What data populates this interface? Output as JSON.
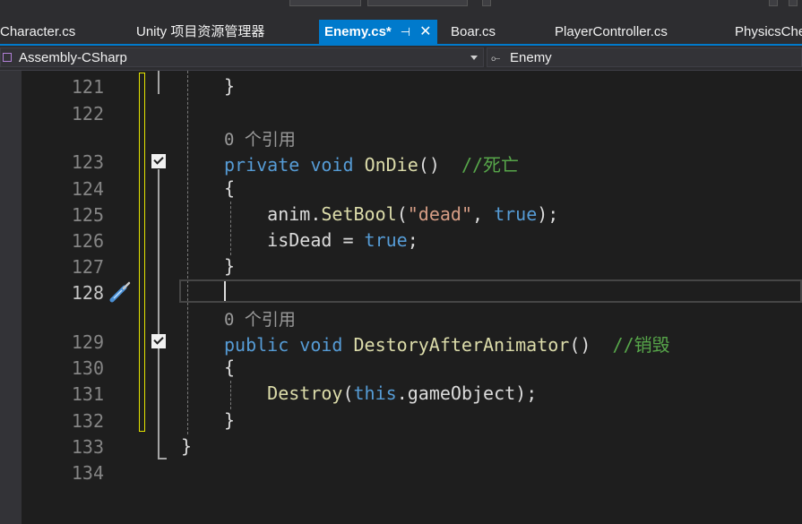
{
  "tabs": [
    {
      "label": "Character.cs",
      "active": false
    },
    {
      "label": "Unity 项目资源管理器",
      "active": false
    },
    {
      "label": "Enemy.cs*",
      "active": true
    },
    {
      "label": "Boar.cs",
      "active": false
    },
    {
      "label": "PlayerController.cs",
      "active": false
    },
    {
      "label": "PhysicsChe",
      "active": false
    }
  ],
  "tab_icons": {
    "pin": "pin-icon",
    "close": "close-icon"
  },
  "navbar": {
    "project": "Assembly-CSharp",
    "class": "Enemy",
    "project_icon": "cs-project-icon",
    "class_icon": "class-icon"
  },
  "editor": {
    "line_numbers": [
      "121",
      "122",
      "123",
      "124",
      "125",
      "126",
      "127",
      "128",
      "129",
      "130",
      "131",
      "132",
      "133",
      "134"
    ],
    "codelens_1": "0 个引用",
    "codelens_2": "0 个引用",
    "tokens": {
      "brace_close_121": "}",
      "kw_private": "private",
      "kw_void_1": "void",
      "method_ondie": "OnDie",
      "parens_1": "()",
      "comment_1": "//死亡",
      "brace_open_124": "{",
      "anim": "anim",
      "dot": ".",
      "setbool": "SetBool",
      "paren_open": "(",
      "str_dead": "\"dead\"",
      "comma": ", ",
      "kw_true_1": "true",
      "paren_close_semi": ");",
      "isdead": "isDead",
      "assign": " = ",
      "kw_true_2": "true",
      "semi": ";",
      "brace_close_127": "}",
      "kw_public": "public",
      "kw_void_2": "void",
      "method_destory": "DestoryAfterAnimator",
      "parens_2": "()",
      "comment_2": "//销毁",
      "brace_open_130": "{",
      "destroy": "Destroy",
      "kw_this": "this",
      "gameobject": "gameObject",
      "brace_close_132": "}",
      "brace_close_133": "}"
    },
    "gutter_icon": "screwdriver-brush-icon",
    "colors": {
      "keyword": "#569cd6",
      "method": "#dcdcaa",
      "string": "#d69d85",
      "comment": "#57a64a",
      "accent": "#007acc",
      "change_marker": "#e5e500"
    }
  }
}
